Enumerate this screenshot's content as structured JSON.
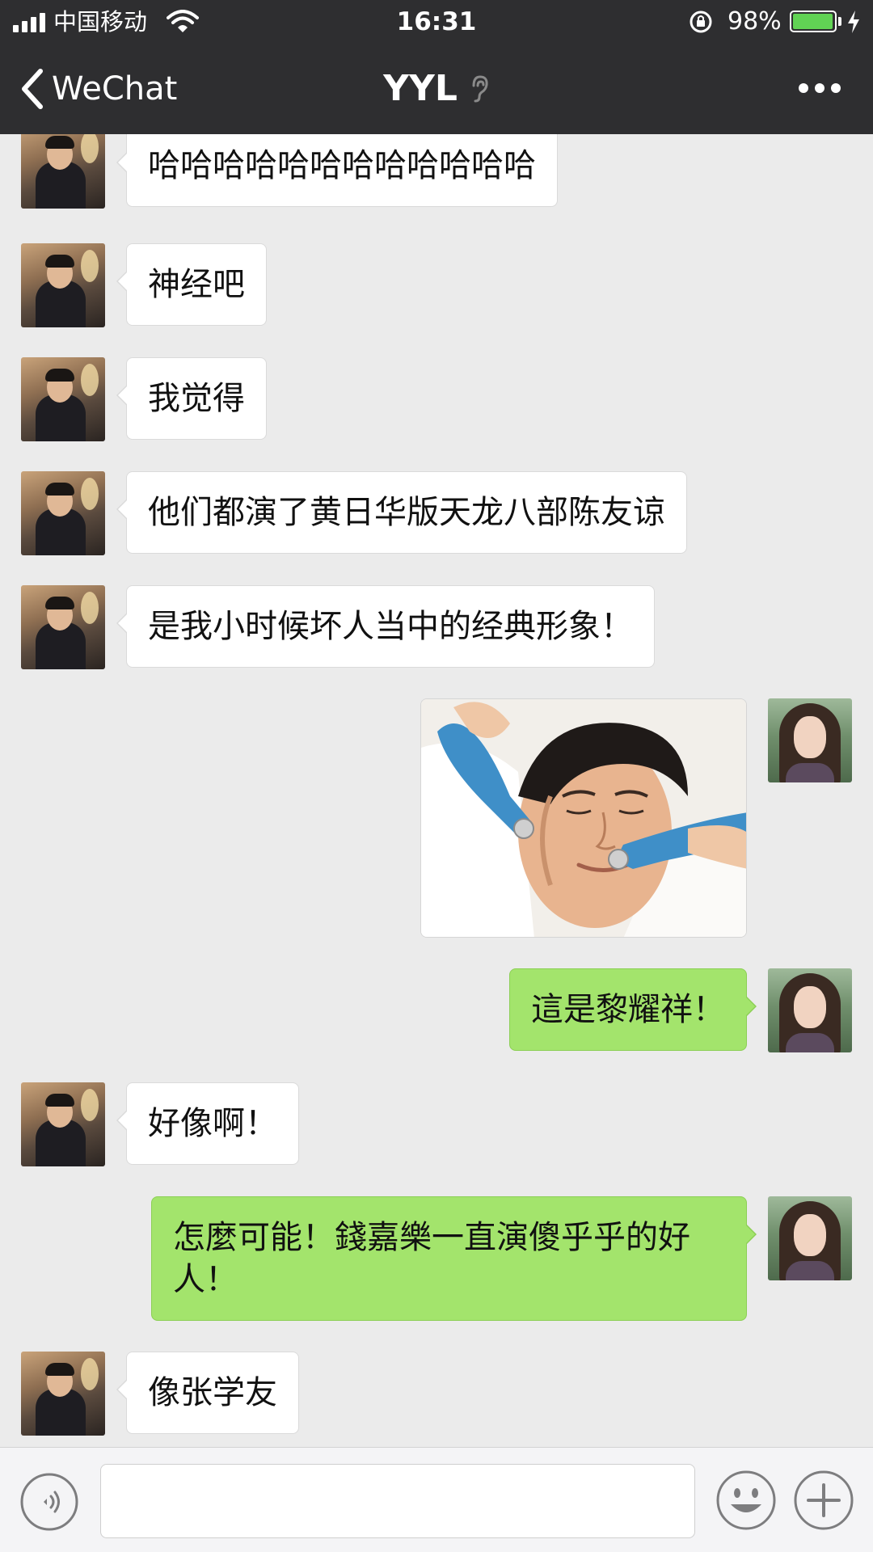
{
  "status_bar": {
    "carrier": "中国移动",
    "time": "16:31",
    "battery_percent_label": "98%",
    "battery_level": 0.98,
    "battery_color": "#61d354"
  },
  "nav": {
    "back_label": "WeChat",
    "title": "YYL",
    "icons": [
      "back-chevron-icon",
      "ear-icon",
      "more-icon"
    ]
  },
  "messages": [
    {
      "side": "left",
      "text": "哈哈哈哈哈哈哈哈哈哈哈哈"
    },
    {
      "side": "left",
      "text": "神经吧"
    },
    {
      "side": "left",
      "text": "我觉得"
    },
    {
      "side": "left",
      "text": "他们都演了黄日华版天龙八部陈友谅"
    },
    {
      "side": "left",
      "text": "是我小时候坏人当中的经典形象！"
    },
    {
      "side": "right",
      "type": "image"
    },
    {
      "side": "right",
      "text": "這是黎耀祥！"
    },
    {
      "side": "left",
      "text": "好像啊！"
    },
    {
      "side": "right",
      "text": "怎麼可能！錢嘉樂一直演傻乎乎的好人！"
    },
    {
      "side": "left",
      "text": "像张学友"
    }
  ],
  "colors": {
    "nav_bg": "#2e2e30",
    "chat_bg": "#ebebeb",
    "sent_bubble": "#a3e46c",
    "received_bubble": "#ffffff"
  },
  "input_bar": {
    "icons": [
      "voice-icon",
      "emoji-icon",
      "plus-icon"
    ]
  }
}
